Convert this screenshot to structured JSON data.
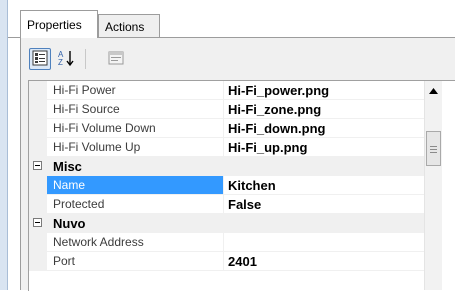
{
  "tabs": [
    {
      "label": "Properties",
      "active": true
    },
    {
      "label": "Actions",
      "active": false
    }
  ],
  "toolbar": {
    "categorized_icon": "categorized-icon",
    "alphabetical_icon": "sort-alphabetical-icon",
    "property_pages_icon": "property-pages-icon"
  },
  "grid": {
    "rows": [
      {
        "type": "property",
        "name": "Hi-Fi Power",
        "value": "Hi-Fi_power.png"
      },
      {
        "type": "property",
        "name": "Hi-Fi Source",
        "value": "Hi-Fi_zone.png"
      },
      {
        "type": "property",
        "name": "Hi-Fi Volume Down",
        "value": "Hi-Fi_down.png"
      },
      {
        "type": "property",
        "name": "Hi-Fi Volume Up",
        "value": "Hi-Fi_up.png"
      },
      {
        "type": "category",
        "name": "Misc",
        "expanded": true
      },
      {
        "type": "property",
        "name": "Name",
        "value": "Kitchen",
        "selected": true
      },
      {
        "type": "property",
        "name": "Protected",
        "value": "False"
      },
      {
        "type": "category",
        "name": "Nuvo",
        "expanded": true
      },
      {
        "type": "property",
        "name": "Network Address",
        "value": ""
      },
      {
        "type": "property",
        "name": "Port",
        "value": "2401"
      }
    ]
  },
  "colors": {
    "selection": "#3399ff",
    "category_background": "#f0f0f0"
  }
}
